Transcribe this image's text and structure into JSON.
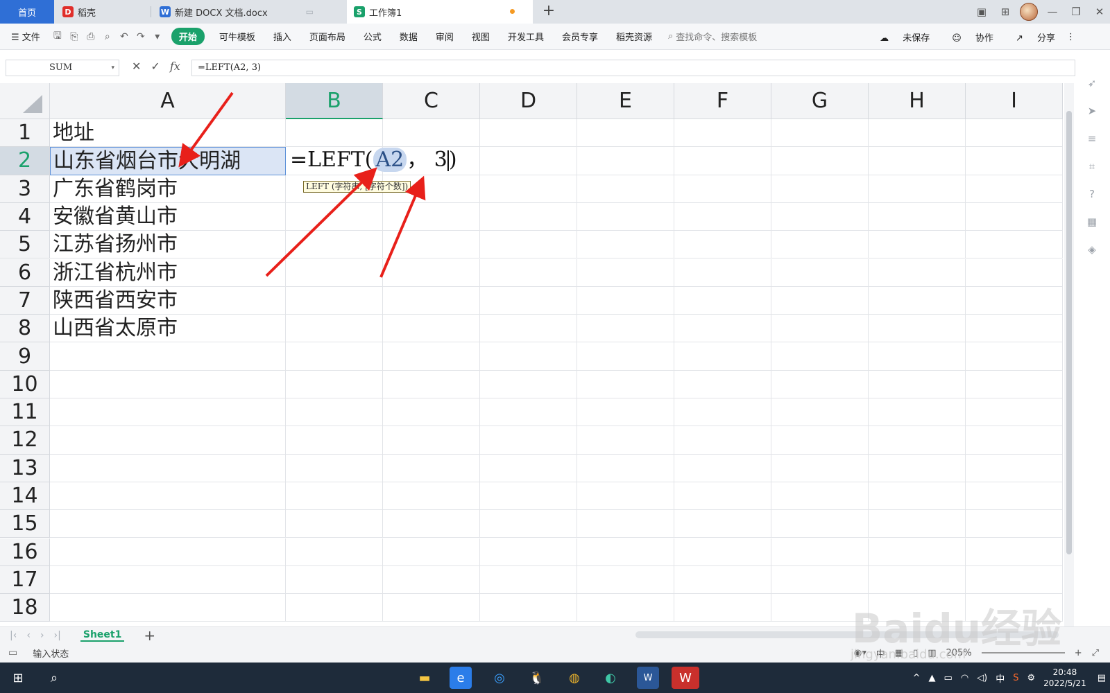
{
  "tabs": {
    "home": "首页",
    "daoke": "稻壳",
    "docx": "新建 DOCX 文档.docx",
    "workbook": "工作簿1"
  },
  "ribbon": {
    "file": "文件",
    "start": "开始",
    "templates": "可牛模板",
    "insert": "插入",
    "layout": "页面布局",
    "formula": "公式",
    "data": "数据",
    "review": "审阅",
    "view": "视图",
    "devtools": "开发工具",
    "member": "会员专享",
    "resources": "稻壳资源",
    "search_placeholder": "查找命令、搜索模板",
    "unsaved": "未保存",
    "collab": "协作",
    "share": "分享"
  },
  "formula_bar": {
    "name_box": "SUM",
    "formula": "=LEFT(A2, 3)"
  },
  "grid": {
    "columns": [
      "A",
      "B",
      "C",
      "D",
      "E",
      "F",
      "G",
      "H",
      "I"
    ],
    "rows": [
      "1",
      "2",
      "3",
      "4",
      "5",
      "6",
      "7",
      "8",
      "9",
      "10",
      "11",
      "12",
      "13",
      "14",
      "15",
      "16",
      "17",
      "18"
    ],
    "column_a": [
      "地址",
      "山东省烟台市大明湖",
      "广东省鹤岗市",
      "安徽省黄山市",
      "江苏省扬州市",
      "浙江省杭州市",
      "陕西省西安市",
      "山西省太原市"
    ],
    "edit_prefix": "=LEFT(",
    "edit_ref": "A2",
    "edit_suffix": "， 3",
    "edit_close": ")",
    "tooltip": "LEFT (字符串, [字符个数])"
  },
  "sheets": {
    "active": "Sheet1"
  },
  "status": {
    "mode": "输入状态",
    "zoom": "205%",
    "ime": "中"
  },
  "taskbar": {
    "time": "20:48",
    "date": "2022/5/21",
    "ime": "中"
  },
  "watermark": {
    "brand": "Baidu经验",
    "url": "jingyan.baidu.com"
  },
  "colors": {
    "accent": "#1aa16b",
    "home_tab": "#2f6fd6",
    "arrow": "#e8201a"
  }
}
